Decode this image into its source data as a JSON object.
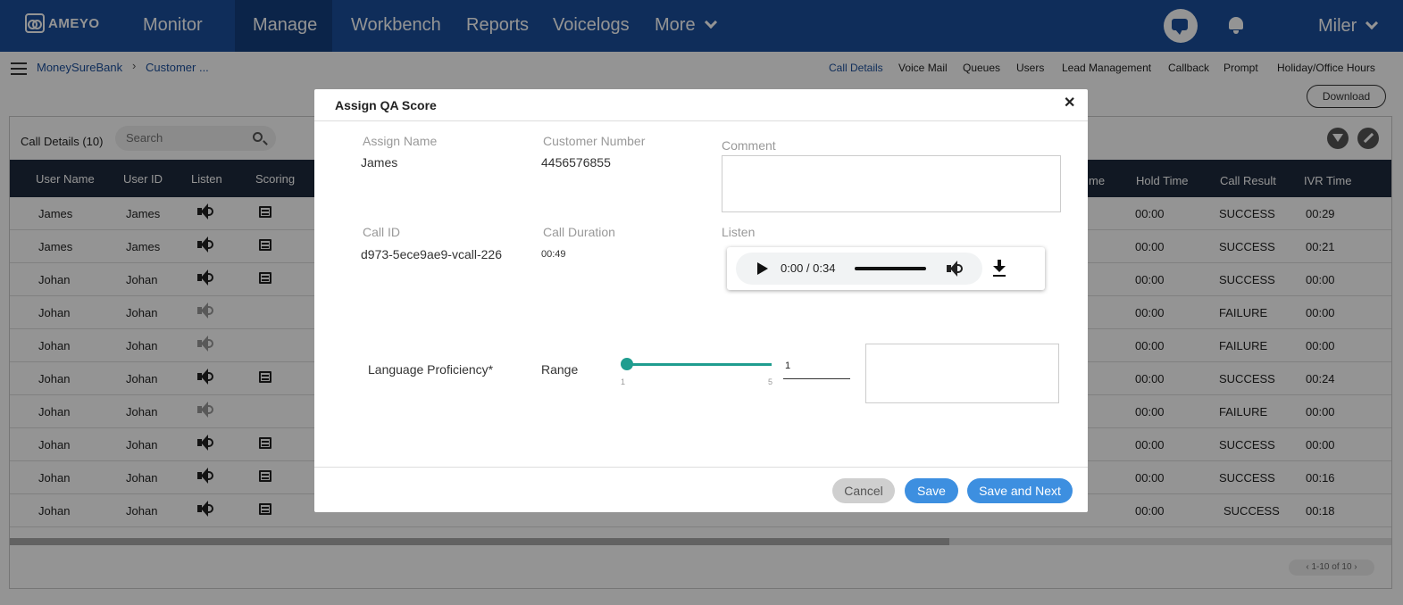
{
  "brand": {
    "logo_text": "AMEYO"
  },
  "nav": {
    "items": [
      "Monitor",
      "Manage",
      "Workbench",
      "Reports",
      "Voicelogs"
    ],
    "more_label": "More",
    "active": "Manage",
    "user": "Miler"
  },
  "breadcrumb": {
    "root": "MoneySureBank",
    "current": "Customer ..."
  },
  "subnav": [
    "Call Details",
    "Voice Mail",
    "Queues",
    "Users",
    "Lead Management",
    "Callback",
    "Prompt",
    "Holiday/Office Hours"
  ],
  "download_label": "Download",
  "table": {
    "title": "Call Details (10)",
    "search_placeholder": "Search",
    "columns_left": [
      "User Name",
      "User ID",
      "Listen",
      "Scoring"
    ],
    "columns_right": [
      "me",
      "Hold Time",
      "Call Result",
      "IVR Time"
    ],
    "rows": [
      {
        "user_name": "James",
        "user_id": "James",
        "listen": true,
        "scoring": true,
        "hold_time": "00:00",
        "call_result": "SUCCESS",
        "ivr_time": "00:29"
      },
      {
        "user_name": "James",
        "user_id": "James",
        "listen": true,
        "scoring": true,
        "hold_time": "00:00",
        "call_result": "SUCCESS",
        "ivr_time": "00:21"
      },
      {
        "user_name": "Johan",
        "user_id": "Johan",
        "listen": true,
        "scoring": true,
        "hold_time": "00:00",
        "call_result": "SUCCESS",
        "ivr_time": "00:00"
      },
      {
        "user_name": "Johan",
        "user_id": "Johan",
        "listen": false,
        "scoring": false,
        "hold_time": "00:00",
        "call_result": "FAILURE",
        "ivr_time": "00:00"
      },
      {
        "user_name": "Johan",
        "user_id": "Johan",
        "listen": false,
        "scoring": false,
        "hold_time": "00:00",
        "call_result": "FAILURE",
        "ivr_time": "00:00"
      },
      {
        "user_name": "Johan",
        "user_id": "Johan",
        "listen": true,
        "scoring": true,
        "hold_time": "00:00",
        "call_result": "SUCCESS",
        "ivr_time": "00:24"
      },
      {
        "user_name": "Johan",
        "user_id": "Johan",
        "listen": false,
        "scoring": false,
        "hold_time": "00:00",
        "call_result": "FAILURE",
        "ivr_time": "00:00"
      },
      {
        "user_name": "Johan",
        "user_id": "Johan",
        "listen": true,
        "scoring": true,
        "hold_time": "00:00",
        "call_result": "SUCCESS",
        "ivr_time": "00:00"
      },
      {
        "user_name": "Johan",
        "user_id": "Johan",
        "listen": true,
        "scoring": true,
        "hold_time": "00:00",
        "call_result": "SUCCESS",
        "ivr_time": "00:16"
      },
      {
        "user_name": "Johan",
        "user_id": "Johan",
        "listen": true,
        "scoring": true,
        "hold_time": "00:00",
        "call_result": "SUCCESS",
        "ivr_time": "00:18"
      }
    ],
    "pager": "1-10 of 10"
  },
  "modal": {
    "title": "Assign QA Score",
    "assign_name_label": "Assign Name",
    "assign_name": "James",
    "customer_number_label": "Customer Number",
    "customer_number": "4456576855",
    "comment_label": "Comment",
    "call_id_label": "Call ID",
    "call_id": "d973-5ece9ae9-vcall-226",
    "call_duration_label": "Call Duration",
    "call_duration": "00:49",
    "listen_label": "Listen",
    "player_time": "0:00 / 0:34",
    "criterion_label": "Language Proficiency*",
    "range_label": "Range",
    "range_min": "1",
    "range_max": "5",
    "range_value": "1",
    "cancel_label": "Cancel",
    "save_label": "Save",
    "save_next_label": "Save and Next"
  },
  "colors": {
    "nav_bg": "#1b4f9c",
    "slider": "#1f9d8f",
    "primary_button": "#3d8fe0",
    "table_header": "#1e2a3d"
  }
}
